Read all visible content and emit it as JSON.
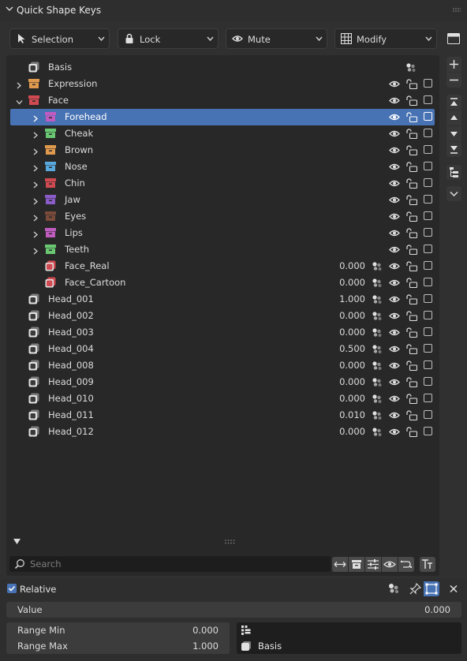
{
  "panel": {
    "title": "Quick Shape Keys"
  },
  "toolbar": {
    "selection_label": "Selection",
    "lock_label": "Lock",
    "mute_label": "Mute",
    "modify_label": "Modify"
  },
  "rows": [
    {
      "label": "Basis",
      "value": ""
    },
    {
      "label": "Expression",
      "color": "#e09a4e"
    },
    {
      "label": "Face",
      "color": "#d04a52"
    },
    {
      "label": "Forehead",
      "color": "#c05cc0"
    },
    {
      "label": "Cheak",
      "color": "#6ac872"
    },
    {
      "label": "Brown",
      "color": "#e09a4e"
    },
    {
      "label": "Nose",
      "color": "#58a8de"
    },
    {
      "label": "Chin",
      "color": "#d04a52"
    },
    {
      "label": "Jaw",
      "color": "#8a5cc8"
    },
    {
      "label": "Eyes",
      "color": "#7a4a3a"
    },
    {
      "label": "Lips",
      "color": "#c05cc0"
    },
    {
      "label": "Teeth",
      "color": "#6ac872"
    },
    {
      "label": "Face_Real",
      "value": "0.000"
    },
    {
      "label": "Face_Cartoon",
      "value": "0.000"
    },
    {
      "label": "Head_001",
      "value": "1.000"
    },
    {
      "label": "Head_002",
      "value": "0.000"
    },
    {
      "label": "Head_003",
      "value": "0.000"
    },
    {
      "label": "Head_004",
      "value": "0.500"
    },
    {
      "label": "Head_008",
      "value": "0.000"
    },
    {
      "label": "Head_009",
      "value": "0.000"
    },
    {
      "label": "Head_010",
      "value": "0.000"
    },
    {
      "label": "Head_011",
      "value": "0.010"
    },
    {
      "label": "Head_012",
      "value": "0.000"
    }
  ],
  "search": {
    "placeholder": "Search"
  },
  "relative": {
    "label": "Relative",
    "checked": true
  },
  "value_field": {
    "label": "Value",
    "value": "0.000"
  },
  "range_min": {
    "label": "Range Min",
    "value": "0.000"
  },
  "range_max": {
    "label": "Range Max",
    "value": "1.000"
  },
  "relative_key": {
    "value": "Basis"
  },
  "colors": {
    "selection": "#4772b3",
    "background": "#303030",
    "list_bg": "#282828"
  }
}
